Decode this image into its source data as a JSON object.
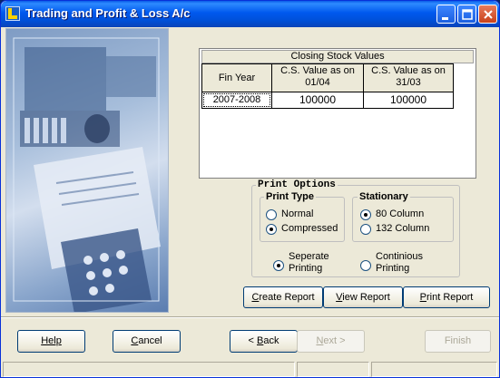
{
  "window": {
    "title": "Trading and Profit & Loss A/c",
    "controls": [
      "minimize-icon",
      "maximize-icon",
      "close-icon"
    ]
  },
  "closing_stock": {
    "title": "Closing Stock Values",
    "headers": {
      "fin_year": "Fin Year",
      "cs_open": "C.S. Value as on 01/04",
      "cs_close": "C.S. Value as on 31/03"
    },
    "rows": [
      {
        "fin_year": "2007-2008",
        "cs_open": "100000",
        "cs_close": "100000"
      }
    ]
  },
  "print_options": {
    "title": "Print Options",
    "print_type": {
      "title": "Print Type",
      "options": [
        "Normal",
        "Compressed"
      ],
      "selected": "Compressed"
    },
    "stationary": {
      "title": "Stationary",
      "options": [
        "80 Column",
        "132 Column"
      ],
      "selected": "80 Column"
    },
    "printing": {
      "options": [
        "Seperate Printing",
        "Continious Printing"
      ],
      "selected": "Seperate Printing",
      "seperate_line1": "Seperate",
      "seperate_line2": "Printing",
      "continious_line1": "Continious",
      "continious_line2": "Printing"
    }
  },
  "report_buttons": {
    "create": "Create Report",
    "view": "View Report",
    "print": "Print Report"
  },
  "wizard_buttons": {
    "help": "Help",
    "cancel": "Cancel",
    "back": "< Back",
    "next": "Next >",
    "finish": "Finish"
  }
}
